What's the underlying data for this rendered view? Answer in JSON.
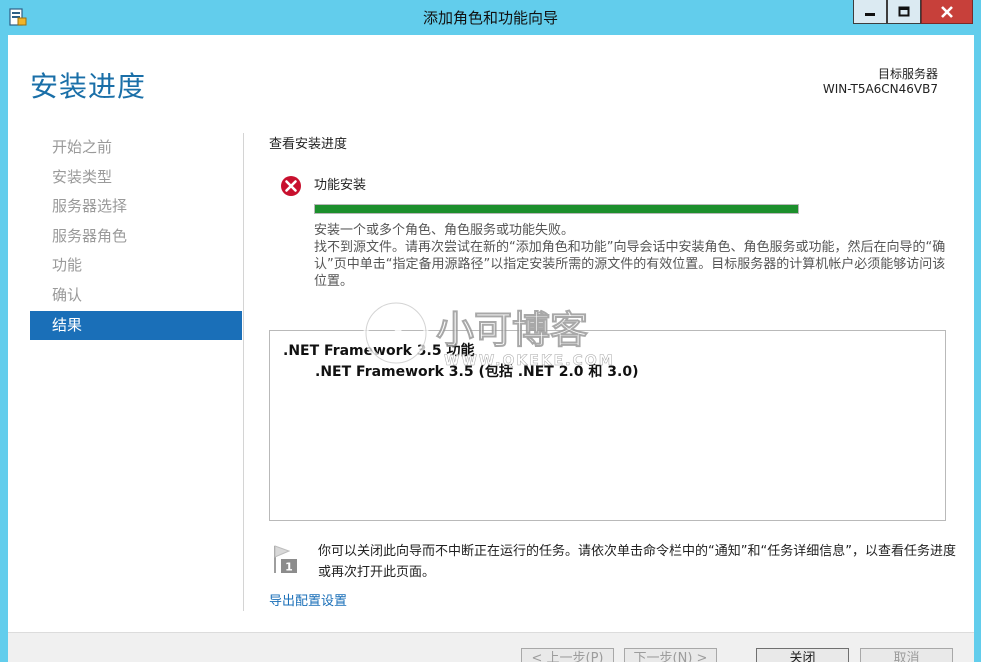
{
  "window": {
    "title": "添加角色和功能向导",
    "controls": {
      "minimize": "minimize-icon",
      "maximize": "maximize-icon",
      "close": "close-icon"
    }
  },
  "header": {
    "page_title": "安装进度",
    "target_label": "目标服务器",
    "target_name": "WIN-T5A6CN46VB7"
  },
  "nav": {
    "items": [
      {
        "label": "开始之前",
        "active": false
      },
      {
        "label": "安装类型",
        "active": false
      },
      {
        "label": "服务器选择",
        "active": false
      },
      {
        "label": "服务器角色",
        "active": false
      },
      {
        "label": "功能",
        "active": false
      },
      {
        "label": "确认",
        "active": false
      },
      {
        "label": "结果",
        "active": true
      }
    ]
  },
  "main": {
    "section_heading": "查看安装进度",
    "feature_label": "功能安装",
    "progress_fraction": 1.0,
    "status_lines": [
      "安装一个或多个角色、角色服务或功能失败。",
      "找不到源文件。请再次尝试在新的“添加角色和功能”向导会话中安装角色、角色服务或功能，然后在向导的“确认”页中单击“指定备用源路径”以指定安装所需的源文件的有效位置。目标服务器的计算机帐户必须能够访问该位置。"
    ],
    "results": [
      ".NET Framework 3.5 功能",
      ".NET Framework 3.5 (包括 .NET 2.0 和 3.0)"
    ],
    "watermark": {
      "name": "小可博客",
      "url": "WWW.QKEKE.COM"
    },
    "note": "你可以关闭此向导而不中断正在运行的任务。请依次单击命令栏中的“通知”和“任务详细信息”，以查看任务进度或再次打开此页面。",
    "export_link": "导出配置设置"
  },
  "footer": {
    "prev": "< 上一步(P)",
    "next": "下一步(N) >",
    "close": "关闭",
    "cancel": "取消"
  },
  "colors": {
    "chrome": "#62cdec",
    "accent": "#1a6fb8",
    "title": "#1a6fa8",
    "error": "#c8102e",
    "close_button": "#c7403a"
  }
}
